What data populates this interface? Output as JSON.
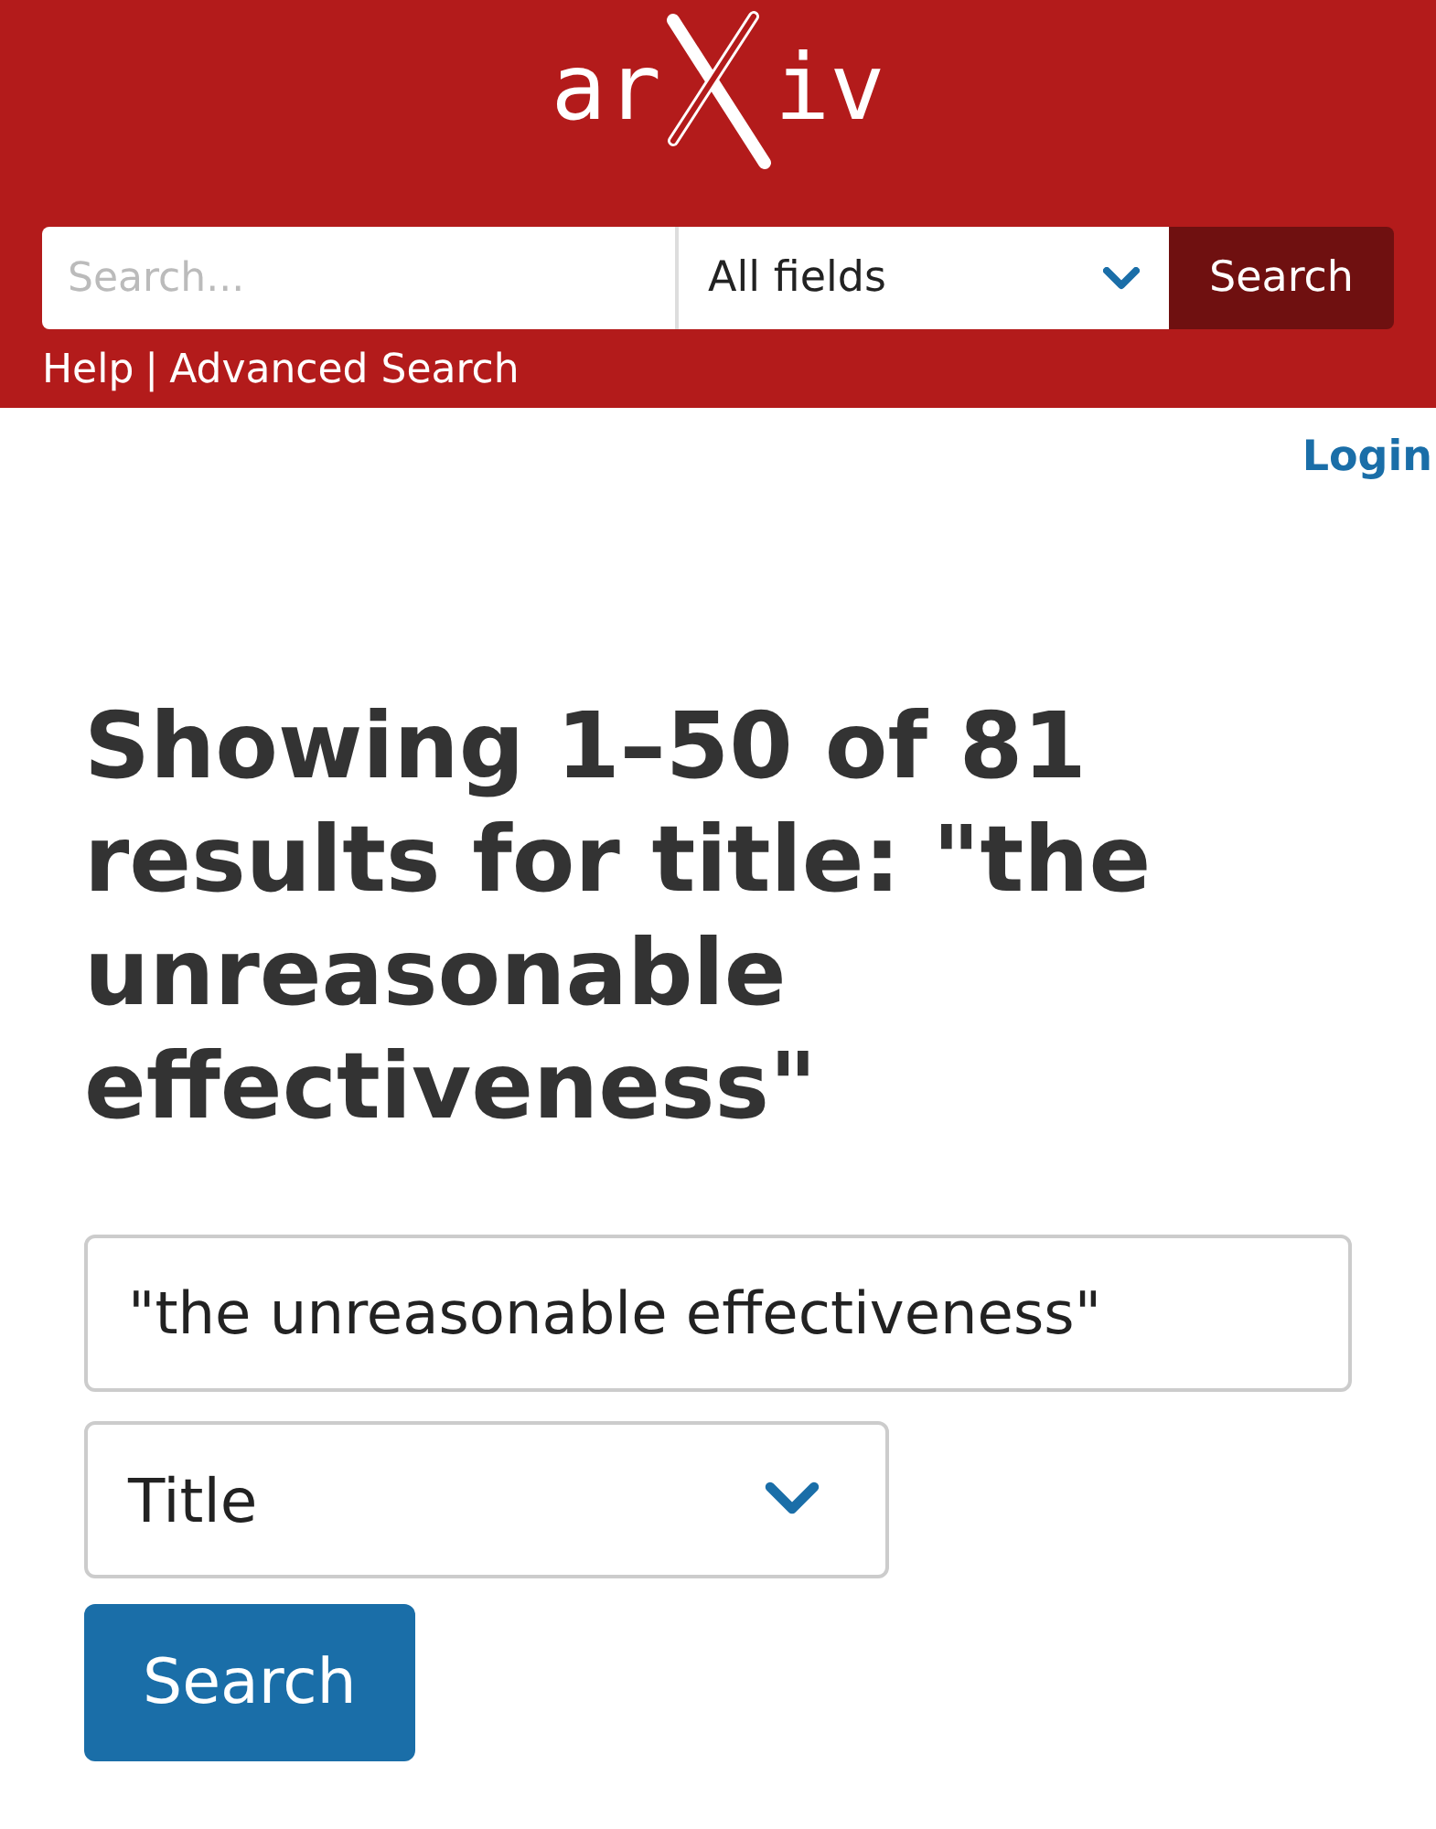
{
  "header": {
    "logo": {
      "before": "ar",
      "after": "iv"
    },
    "search": {
      "placeholder": "Search...",
      "field": "All fields",
      "button": "Search"
    },
    "links": [
      {
        "label": "Help"
      },
      {
        "label": "|"
      },
      {
        "label": "Advanced Search"
      }
    ]
  },
  "login": "Login",
  "heading": "Showing 1–50 of 81 results for title: \"the unreasonable effectiveness\"",
  "query": {
    "value": "\"the unreasonable effectiveness\"",
    "field": "Title",
    "button": "Search"
  }
}
